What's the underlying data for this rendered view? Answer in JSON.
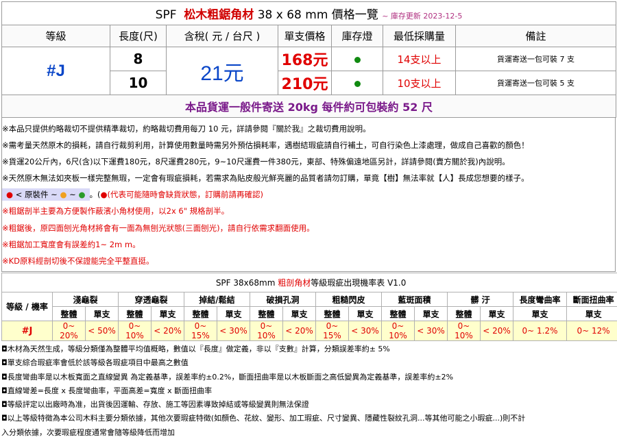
{
  "title": {
    "prefix": "SPF",
    "name": "松木粗鋸角材",
    "dims": "38 x 68 mm",
    "suffix": "價格一覽",
    "update": "~ 庫存更新 2023-12-5"
  },
  "headers": [
    "等級",
    "長度(尺)",
    "含稅( 元 / 台尺 )",
    "單支價格",
    "庫存燈",
    "最低採購量",
    "備註"
  ],
  "grade": "#J",
  "tax_price": "21元",
  "rows": [
    {
      "length": "8",
      "price": "168元",
      "stock": "green",
      "min": "14支以上",
      "note": "貨運寄送一包可裝 7 支"
    },
    {
      "length": "10",
      "price": "210元",
      "stock": "green",
      "min": "10支以上",
      "note": "貨運寄送一包可裝 5 支"
    }
  ],
  "shipping": "本品貨運一般件寄送 20kg 每件約可包裝約 52 尺",
  "notes": {
    "n1": "※本品只提供約略裁切不提供精準裁切，約略裁切費用每刀 10 元，詳請參閱『關於我』之裁切費用說明。",
    "n2": "※需考量天然原木的損耗，請自行裁剪利用，計算使用數量時需另外預估損耗率，遇樹結瑕疵請自行補土，可自行染色上漆處理，做成自己喜歡的顏色！",
    "n3": "※貨運20公斤內，6尺(含)以下運費180元，8尺運費280元，9~10尺運費一件380元，東部、特殊偏遠地區另計，詳請參閱(賣方關於我)內說明。",
    "n4": "※天然原木無法如夾板一樣完整無瑕，一定會有瑕疵損耗，若需求為貼皮般光鮮亮麗的品質者請勿訂購，單竟【樹】無法率就【人】長成您想要的樣子。",
    "legend_label": "< 原裝件  ~",
    "legend_tilde": "~",
    "legend_note": "(代表可能隨時會缺貨狀態，訂購前請再確認)",
    "n6": "※粗鋸剖半主要為方便製作蔽濱小角材使用，以2x 6\" 規格剖半。",
    "n7": "※粗鋸後，原四面刨光角材將會有一面為無刨光狀態(三面刨光)，請自行依需求翻面使用。",
    "n8": "※粗鋸加工寬度會有誤差約1~ 2m m。",
    "n9": "※KD原料經剖切後不保證能完全平整直挺。"
  },
  "defect": {
    "title_prefix": "SPF 38x68mm",
    "title_red": "粗剖角材",
    "title_suffix": "等級瑕疵出現機率表 V1.0",
    "corner": "等級 / 機率",
    "categories": [
      "淺龜裂",
      "穿透龜裂",
      "掉結/鬆結",
      "破損孔洞",
      "粗糙閃皮",
      "藍斑面積",
      "髒 汙",
      "長度彎曲率",
      "斷面扭曲率"
    ],
    "sub_whole": "整體",
    "sub_single": "單支",
    "grade": "#J",
    "values": [
      "0~ 20%",
      "< 50%",
      "0~ 10%",
      "< 20%",
      "0~ 15%",
      "< 30%",
      "0~ 10%",
      "< 20%",
      "0~ 15%",
      "< 30%",
      "0~ 10%",
      "< 30%",
      "0~ 10%",
      "< 20%",
      "0~ 1.2%",
      "0~ 12%"
    ]
  },
  "footnotes": [
    "◘木材為天然生成，等級分類僅為整體平均值概略，數值以『長度』做定義，非以『支數』計算，分類誤差率約± 5%",
    "◘單支綜合瑕疵率會低於該等級各瑕疵項目中最高之數值",
    "◘長度彎曲率是以木板寬面之直線變異 為定義基準，誤差率約±0.2%，斷面扭曲率是以木板斷面之高低變異為定義基準，誤差率約±2%",
    "◘直線彎差=長度 x 長度彎曲率，平面高差=寬度 x 斷面扭曲率",
    "◘等級評定以出廠時為准，出貨後因運輸、存放、施工等因素導致掉結或等級變異則無法保證",
    "◘以上等級特徵為本公司木料主要分類依據，其他次要瑕疵特徵(如顏色、花紋、變形、加工瑕疵、尺寸變異、隱藏性裂紋孔洞...等其他可能之小瑕疵...)則不計",
    "入分類依據，次要瑕疵程度通常會隨等級降低而增加"
  ],
  "colors": {
    "accent_blue": "#0a46c8",
    "price_red": "#e00000",
    "stock_green": "#118a11",
    "ship_purple": "#7a1a8a",
    "row_yellow": "#ffffcc"
  }
}
